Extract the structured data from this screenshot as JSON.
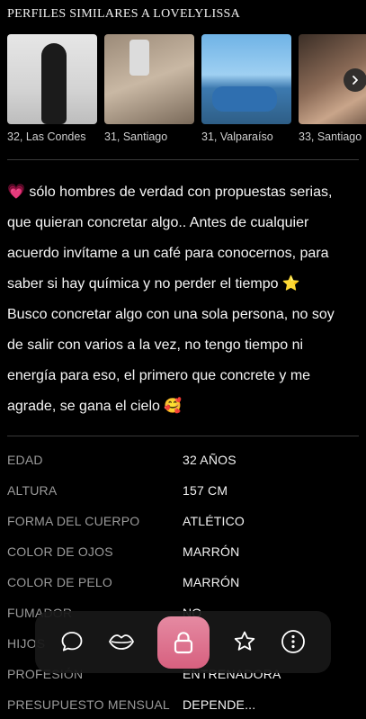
{
  "similar": {
    "title": "PERFILES SIMILARES A LOVELYLISSA",
    "profiles": [
      {
        "caption": "32, Las Condes"
      },
      {
        "caption": "31, Santiago"
      },
      {
        "caption": "31, Valparaíso"
      },
      {
        "caption": "33, Santiago"
      }
    ]
  },
  "bio": {
    "lines": [
      "💗 sólo hombres de verdad con propuestas serias,",
      "que quieran concretar algo.. Antes de cualquier",
      "acuerdo invítame a un café para conocernos, para",
      "saber si hay química y no perder el tiempo ⭐",
      "Busco concretar algo con una sola persona, no soy",
      "de salir con varios a la vez, no tengo tiempo ni",
      "energía para eso, el primero que concrete y me",
      "agrade, se gana el cielo 🥰"
    ]
  },
  "details": [
    {
      "label": "EDAD",
      "value": "32 AÑOS"
    },
    {
      "label": "ALTURA",
      "value": "157 CM"
    },
    {
      "label": "FORMA DEL CUERPO",
      "value": "ATLÉTICO"
    },
    {
      "label": "COLOR DE OJOS",
      "value": "MARRÓN"
    },
    {
      "label": "COLOR DE PELO",
      "value": "MARRÓN"
    },
    {
      "label": "FUMADOR",
      "value": "NO"
    },
    {
      "label": "HIJOS",
      "value": "NO"
    },
    {
      "label": "PROFESIÓN",
      "value": "ENTRENADORA"
    },
    {
      "label": "PRESUPUESTO MENSUAL",
      "value": "DEPENDE..."
    }
  ],
  "dock": {
    "icons": [
      "chat-icon",
      "kiss-icon",
      "lock-icon",
      "star-icon",
      "more-icon"
    ],
    "accent": "#d96a86"
  }
}
